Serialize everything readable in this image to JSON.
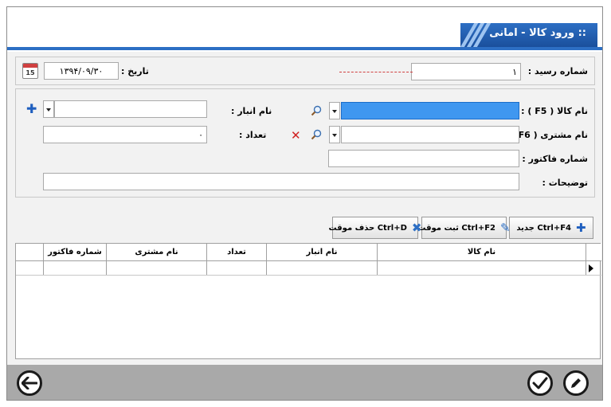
{
  "window": {
    "title": ":: ورود کالا - امانی"
  },
  "receipt": {
    "number_label": "شماره رسید :",
    "number_value": "۱",
    "date_label": "تاریخ :",
    "date_value": "۱۳۹۴/۰۹/۳۰",
    "calendar_day": "15"
  },
  "form": {
    "product_label": "نام کالا ( F5 ) :",
    "warehouse_label": "نام انبار :",
    "customer_label": "نام مشتری ( F6 ) :",
    "quantity_label": "تعداد :",
    "quantity_value": "۰",
    "invoice_label": "شماره فاکتور :",
    "notes_label": "توضیحات :"
  },
  "toolbar": {
    "new_label": "جدید Ctrl+F4",
    "save_temp_label": "ثبت موقت Ctrl+F2",
    "delete_temp_label": "حذف موقت Ctrl+D"
  },
  "grid": {
    "columns": [
      "شماره فاکتور",
      "نام مشتری",
      "تعداد",
      "نام انبار",
      "نام کالا"
    ]
  },
  "colors": {
    "accent": "#2d6fc4",
    "selected_field": "#3f97f0",
    "bottom_bar": "#a9a9a9"
  }
}
